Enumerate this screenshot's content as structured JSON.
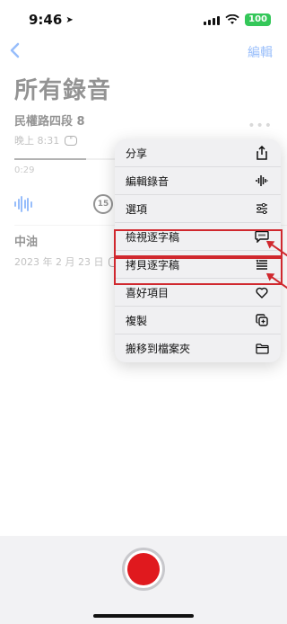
{
  "status_bar": {
    "time": "9:46",
    "battery": "100"
  },
  "nav": {
    "edit_label": "編輯"
  },
  "page_title": "所有錄音",
  "recordings": [
    {
      "title": "民權路四段 8",
      "meta": "晚上 8:31",
      "elapsed": "0:29"
    },
    {
      "title": "中油",
      "meta": "2023 年 2 月 23 日"
    }
  ],
  "player": {
    "skip_label": "15"
  },
  "menu": {
    "items": [
      {
        "label": "分享",
        "icon": "share-icon"
      },
      {
        "label": "編輯錄音",
        "icon": "waveform-icon"
      },
      {
        "label": "選項",
        "icon": "sliders-icon"
      },
      {
        "label": "檢視逐字稿",
        "icon": "transcript-bubble-icon"
      },
      {
        "label": "拷貝逐字稿",
        "icon": "copy-transcript-icon"
      },
      {
        "label": "喜好項目",
        "icon": "heart-icon"
      },
      {
        "label": "複製",
        "icon": "duplicate-icon"
      },
      {
        "label": "搬移到檔案夾",
        "icon": "folder-icon"
      }
    ]
  },
  "colors": {
    "accent": "#1a6ef5",
    "record": "#e0191e",
    "highlight": "#d0282e"
  }
}
